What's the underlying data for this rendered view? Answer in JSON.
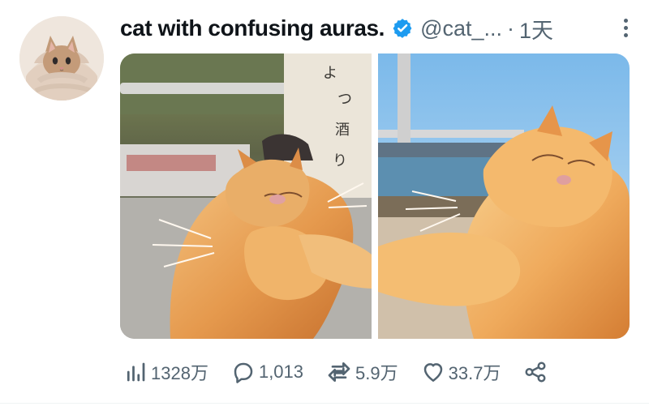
{
  "tweet": {
    "display_name": "cat with confusing auras.",
    "handle": "@cat_...",
    "separator": "·",
    "time": "1天",
    "avatar_icon": "kitten-in-blanket-avatar-icon",
    "verified_icon": "verified-badge-icon",
    "more_icon": "more-options-icon"
  },
  "media": [
    {
      "name": "orange-cat-being-hit-photo"
    },
    {
      "name": "orange-cat-pushing-photo"
    }
  ],
  "actions": {
    "views": {
      "icon": "views-bar-chart-icon",
      "count": "1328万"
    },
    "replies": {
      "icon": "reply-bubble-icon",
      "count": "1,013"
    },
    "retweets": {
      "icon": "retweet-icon",
      "count": "5.9万"
    },
    "likes": {
      "icon": "heart-icon",
      "count": "33.7万"
    },
    "share": {
      "icon": "share-icon"
    }
  },
  "colors": {
    "accent": "#1d9bf0",
    "text": "#0f1419",
    "secondary": "#536471"
  }
}
